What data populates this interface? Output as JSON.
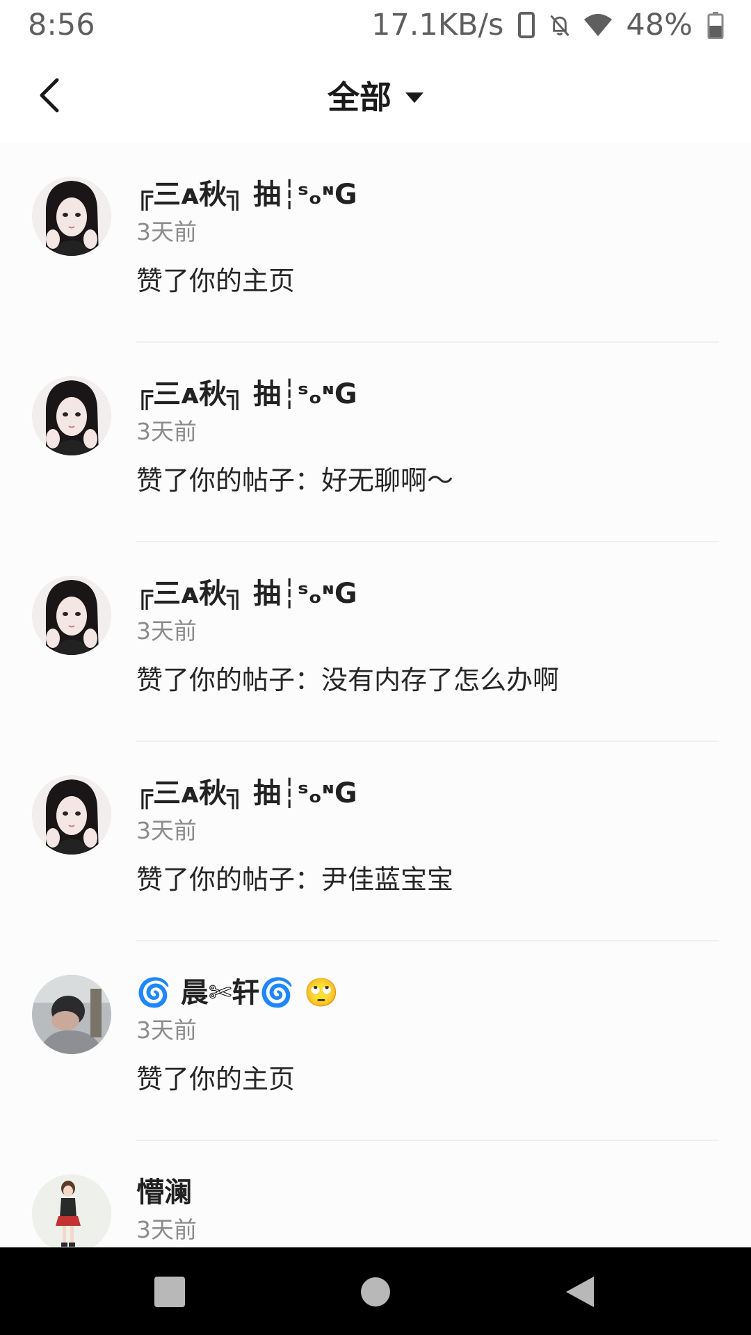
{
  "status_bar": {
    "time": "8:56",
    "net_speed": "17.1KB/s",
    "battery": "48%",
    "icons": [
      "phone-icon",
      "bell-off-icon",
      "wifi-icon",
      "battery-icon"
    ]
  },
  "header": {
    "title": "全部",
    "back_icon": "chevron-left-icon",
    "dropdown_icon": "caret-down-icon"
  },
  "notifications": [
    {
      "name": "╔三ᴀ秋╗ 抽┆ˢₒᶰG",
      "time": "3天前",
      "action": "赞了你的主页",
      "avatar": "avatar-girl-dark"
    },
    {
      "name": "╔三ᴀ秋╗ 抽┆ˢₒᶰG",
      "time": "3天前",
      "action": "赞了你的帖子：好无聊啊～",
      "avatar": "avatar-girl-dark"
    },
    {
      "name": "╔三ᴀ秋╗ 抽┆ˢₒᶰG",
      "time": "3天前",
      "action": "赞了你的帖子：没有内存了怎么办啊",
      "avatar": "avatar-girl-dark"
    },
    {
      "name": "╔三ᴀ秋╗ 抽┆ˢₒᶰG",
      "time": "3天前",
      "action": "赞了你的帖子：尹佳蓝宝宝",
      "avatar": "avatar-girl-dark"
    },
    {
      "name": "🌀 晨✄轩🌀 🙄",
      "time": "3天前",
      "action": "赞了你的主页",
      "avatar": "avatar-photo"
    },
    {
      "name": "懵澜",
      "time": "3天前",
      "action": "",
      "avatar": "avatar-cartoon-girl"
    }
  ],
  "nav_bar": {
    "icons": [
      "recents-icon",
      "home-icon",
      "back-icon"
    ]
  },
  "colors": {
    "background": "#fcfcfd",
    "secondary_text": "#8b8b8b",
    "navbar": "#000000"
  }
}
